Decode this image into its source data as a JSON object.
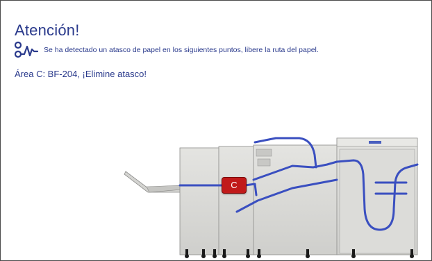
{
  "dialog": {
    "title": "Atención!",
    "message": "Se ha detectado un atasco de papel en los siguientes puntos, libere la ruta del papel.",
    "area_text": "Área C: BF-204, ¡Elimine atasco!"
  },
  "diagram": {
    "jam_area_label": "C"
  },
  "icons": {
    "path": "paper-path-icon"
  },
  "colors": {
    "text": "#2a3a8c",
    "paper_path": "#3a4fc0",
    "jam_badge": "#c11a1a",
    "machine_body": "#d9d9d6"
  }
}
